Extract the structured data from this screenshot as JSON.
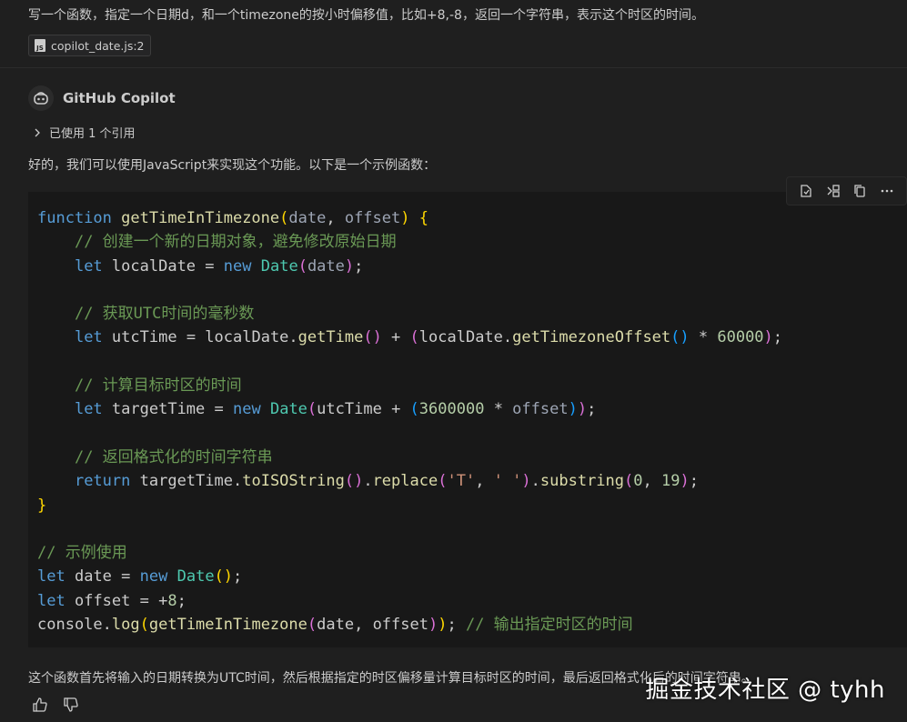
{
  "user_message": {
    "text": "写一个函数，指定一个日期d，和一个timezone的按小时偏移值，比如+8,-8，返回一个字符串，表示这个时区的时间。",
    "attachment": {
      "icon": "js-file-icon",
      "badge": "JS",
      "label": "copilot_date.js:2"
    }
  },
  "response": {
    "agent_name": "GitHub Copilot",
    "references_label": "已使用 1 个引用",
    "intro": "好的，我们可以使用JavaScript来实现这个功能。以下是一个示例函数：",
    "summary": "这个函数首先将输入的日期转换为UTC时间，然后根据指定的时区偏移量计算目标时区的时间，最后返回格式化后的时间字符串。"
  },
  "code_toolbar": {
    "icons": [
      "apply-in-editor-icon",
      "insert-at-cursor-icon",
      "copy-icon",
      "more-actions-icon"
    ]
  },
  "code": {
    "language": "javascript",
    "tokens": {
      "fn_decl": "function",
      "fn_name": "getTimeInTimezone",
      "p_date": "date",
      "p_offset": "offset",
      "c1": "// 创建一个新的日期对象，避免修改原始日期",
      "kw_let": "let",
      "v_local": "localDate",
      "kw_new": "new",
      "cls_date": "Date",
      "c2": "// 获取UTC时间的毫秒数",
      "v_utc": "utcTime",
      "m_gettime": "getTime",
      "m_tzoffset": "getTimezoneOffset",
      "n_60000": "60000",
      "c3": "// 计算目标时区的时间",
      "v_target": "targetTime",
      "n_3600000": "3600000",
      "c4": "// 返回格式化的时间字符串",
      "kw_return": "return",
      "m_iso": "toISOString",
      "m_replace": "replace",
      "s_t": "'T'",
      "s_space": "' '",
      "m_substring": "substring",
      "n_0": "0",
      "n_19": "19",
      "c5": "// 示例使用",
      "v_date": "date",
      "v_offset": "offset",
      "n_8": "8",
      "v_console": "console",
      "m_log": "log",
      "c6": "// 输出指定时区的时间"
    }
  },
  "watermark": "掘金技术社区 @ tyhh"
}
